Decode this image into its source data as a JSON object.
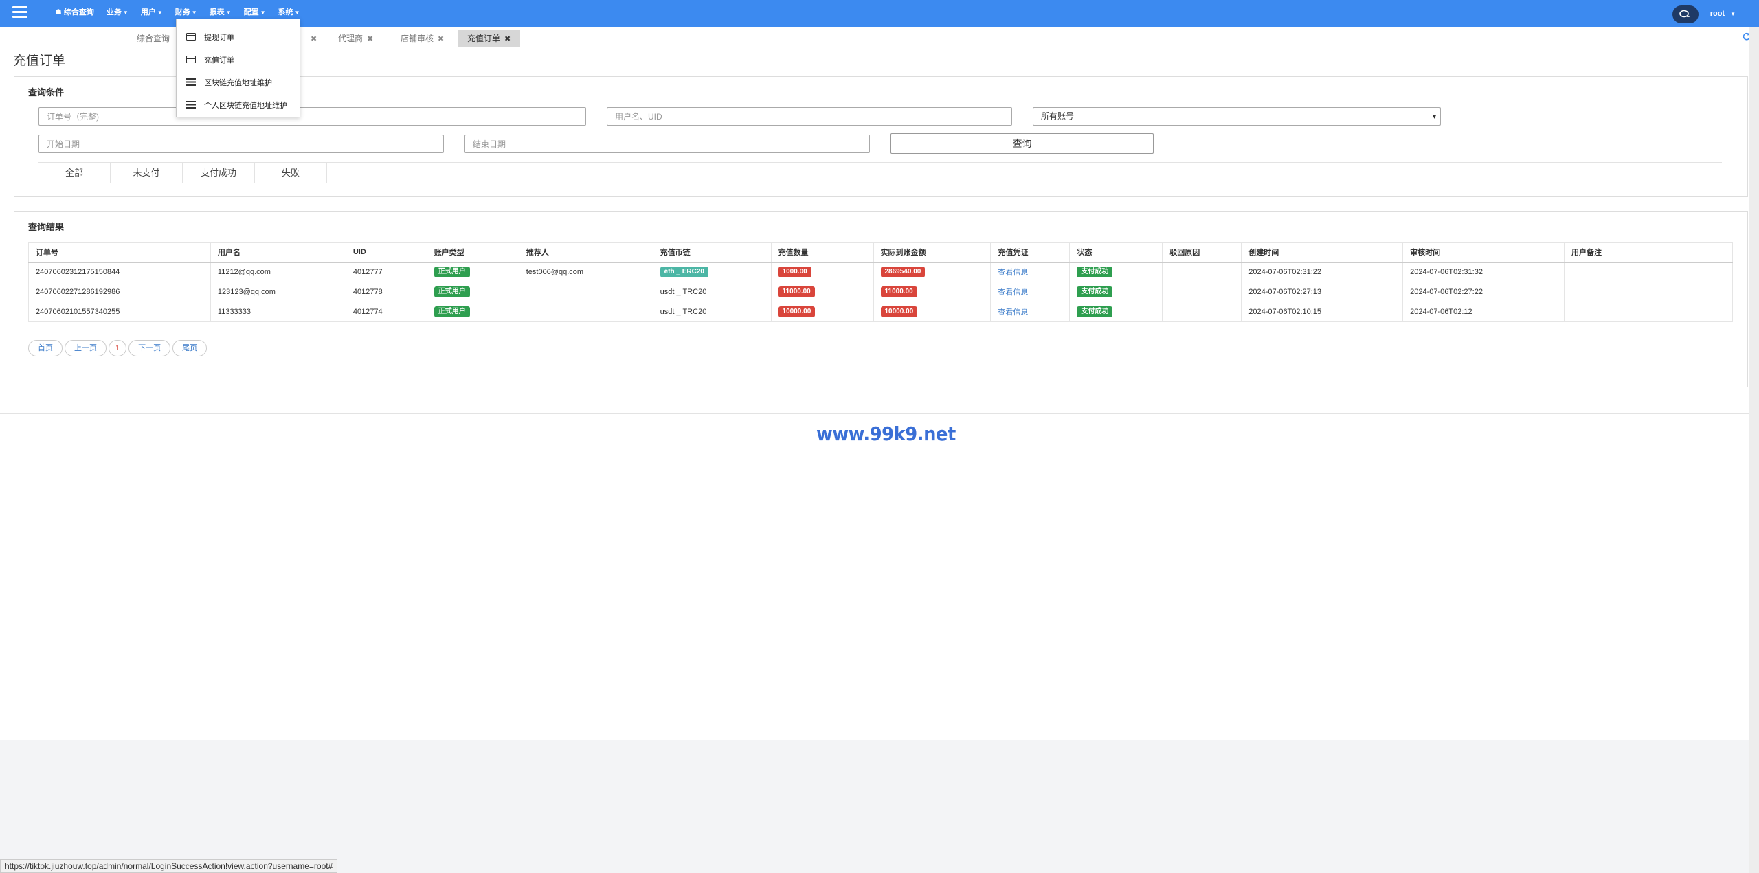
{
  "nav": {
    "items": [
      {
        "label": "综合查询",
        "icon": "home-icon"
      },
      {
        "label": "业务"
      },
      {
        "label": "用户"
      },
      {
        "label": "财务"
      },
      {
        "label": "报表"
      },
      {
        "label": "配置"
      },
      {
        "label": "系统"
      }
    ],
    "user": "root"
  },
  "dropdown": {
    "items": [
      {
        "label": "提现订单",
        "icon": "card-icon"
      },
      {
        "label": "充值订单",
        "icon": "card-icon"
      },
      {
        "label": "区块链充值地址维护",
        "icon": "list-icon"
      },
      {
        "label": "个人区块链充值地址维护",
        "icon": "list-icon"
      }
    ]
  },
  "tabs": [
    {
      "label": "综合查询"
    },
    {
      "label": "代理商"
    },
    {
      "label": "店铺审核"
    },
    {
      "label": "充值订单"
    }
  ],
  "page": {
    "title": "充值订单"
  },
  "query": {
    "title": "查询条件",
    "order_placeholder": "订单号（完整)",
    "user_placeholder": "用户名、UID",
    "account_selected": "所有账号",
    "start_placeholder": "开始日期",
    "end_placeholder": "结束日期",
    "search_label": "查询",
    "status_tabs": [
      "全部",
      "未支付",
      "支付成功",
      "失败"
    ]
  },
  "results": {
    "title": "查询结果",
    "columns": [
      "订单号",
      "用户名",
      "UID",
      "账户类型",
      "推荐人",
      "充值币链",
      "充值数量",
      "实际到账金额",
      "充值凭证",
      "状态",
      "驳回原因",
      "创建时间",
      "审核时间",
      "用户备注",
      ""
    ],
    "rows": [
      {
        "order": "24070602312175150844",
        "user": "11212@qq.com",
        "uid": "4012777",
        "type": "正式用户",
        "referrer": "test006@qq.com",
        "chain": "eth _ ERC20",
        "amount": "1000.00",
        "actual": "2869540.00",
        "proof": "查看信息",
        "status": "支付成功",
        "reject": "",
        "created": "2024-07-06T02:31:22",
        "audited": "2024-07-06T02:31:32",
        "remark": ""
      },
      {
        "order": "24070602271286192986",
        "user": "123123@qq.com",
        "uid": "4012778",
        "type": "正式用户",
        "referrer": "",
        "chain": "usdt _ TRC20",
        "amount": "11000.00",
        "actual": "11000.00",
        "proof": "查看信息",
        "status": "支付成功",
        "reject": "",
        "created": "2024-07-06T02:27:13",
        "audited": "2024-07-06T02:27:22",
        "remark": ""
      },
      {
        "order": "24070602101557340255",
        "user": "11333333",
        "uid": "4012774",
        "type": "正式用户",
        "referrer": "",
        "chain": "usdt _ TRC20",
        "amount": "10000.00",
        "actual": "10000.00",
        "proof": "查看信息",
        "status": "支付成功",
        "reject": "",
        "created": "2024-07-06T02:10:15",
        "audited": "2024-07-06T02:12",
        "remark": ""
      }
    ]
  },
  "pager": {
    "first": "首页",
    "prev": "上一页",
    "current": "1",
    "next": "下一页",
    "last": "尾页"
  },
  "footer": {
    "brand": "www.99k9.net"
  },
  "status_url": "https://tiktok.jiuzhouw.top/admin/normal/LoginSuccessAction!view.action?username=root#",
  "colors": {
    "navbar": "#3c8af0",
    "success": "#2e9e4f",
    "danger": "#d9453b",
    "chain": "#4cb6a5",
    "brand": "#3a6fd6"
  }
}
